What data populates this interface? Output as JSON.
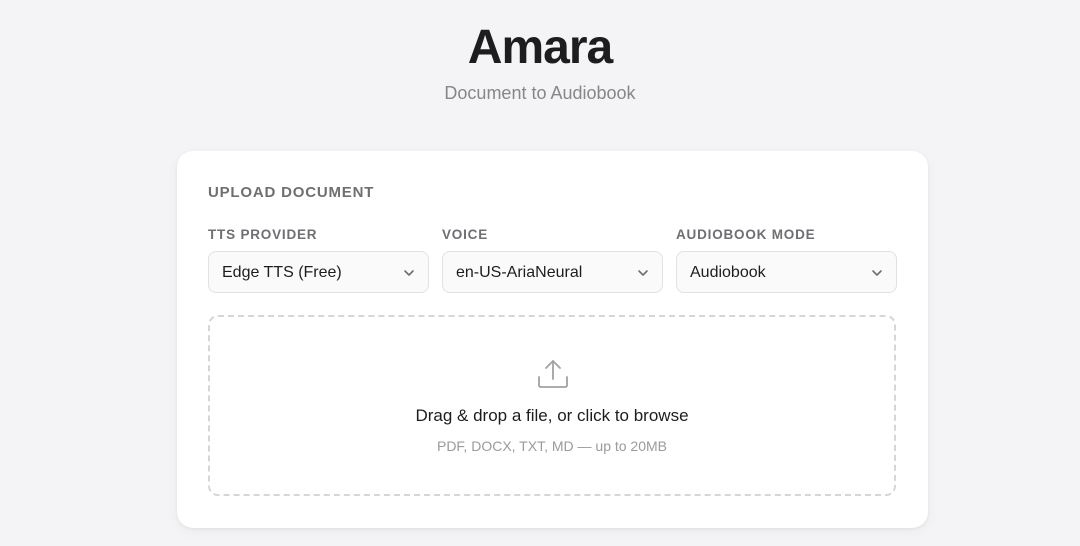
{
  "header": {
    "title": "Amara",
    "subtitle": "Document to Audiobook"
  },
  "upload": {
    "section_title": "UPLOAD DOCUMENT",
    "fields": [
      {
        "label": "TTS PROVIDER",
        "value": "Edge TTS (Free)"
      },
      {
        "label": "VOICE",
        "value": "en-US-AriaNeural"
      },
      {
        "label": "AUDIOBOOK MODE",
        "value": "Audiobook"
      }
    ],
    "dropzone": {
      "title": "Drag & drop a file, or click to browse",
      "hint": "PDF, DOCX, TXT, MD — up to 20MB",
      "icon": "upload-icon"
    }
  },
  "colors": {
    "background": "#f4f4f6",
    "card": "#ffffff",
    "text_primary": "#1d1d1f",
    "text_secondary": "#6e6e73",
    "dashed_border": "#d6d6da"
  }
}
